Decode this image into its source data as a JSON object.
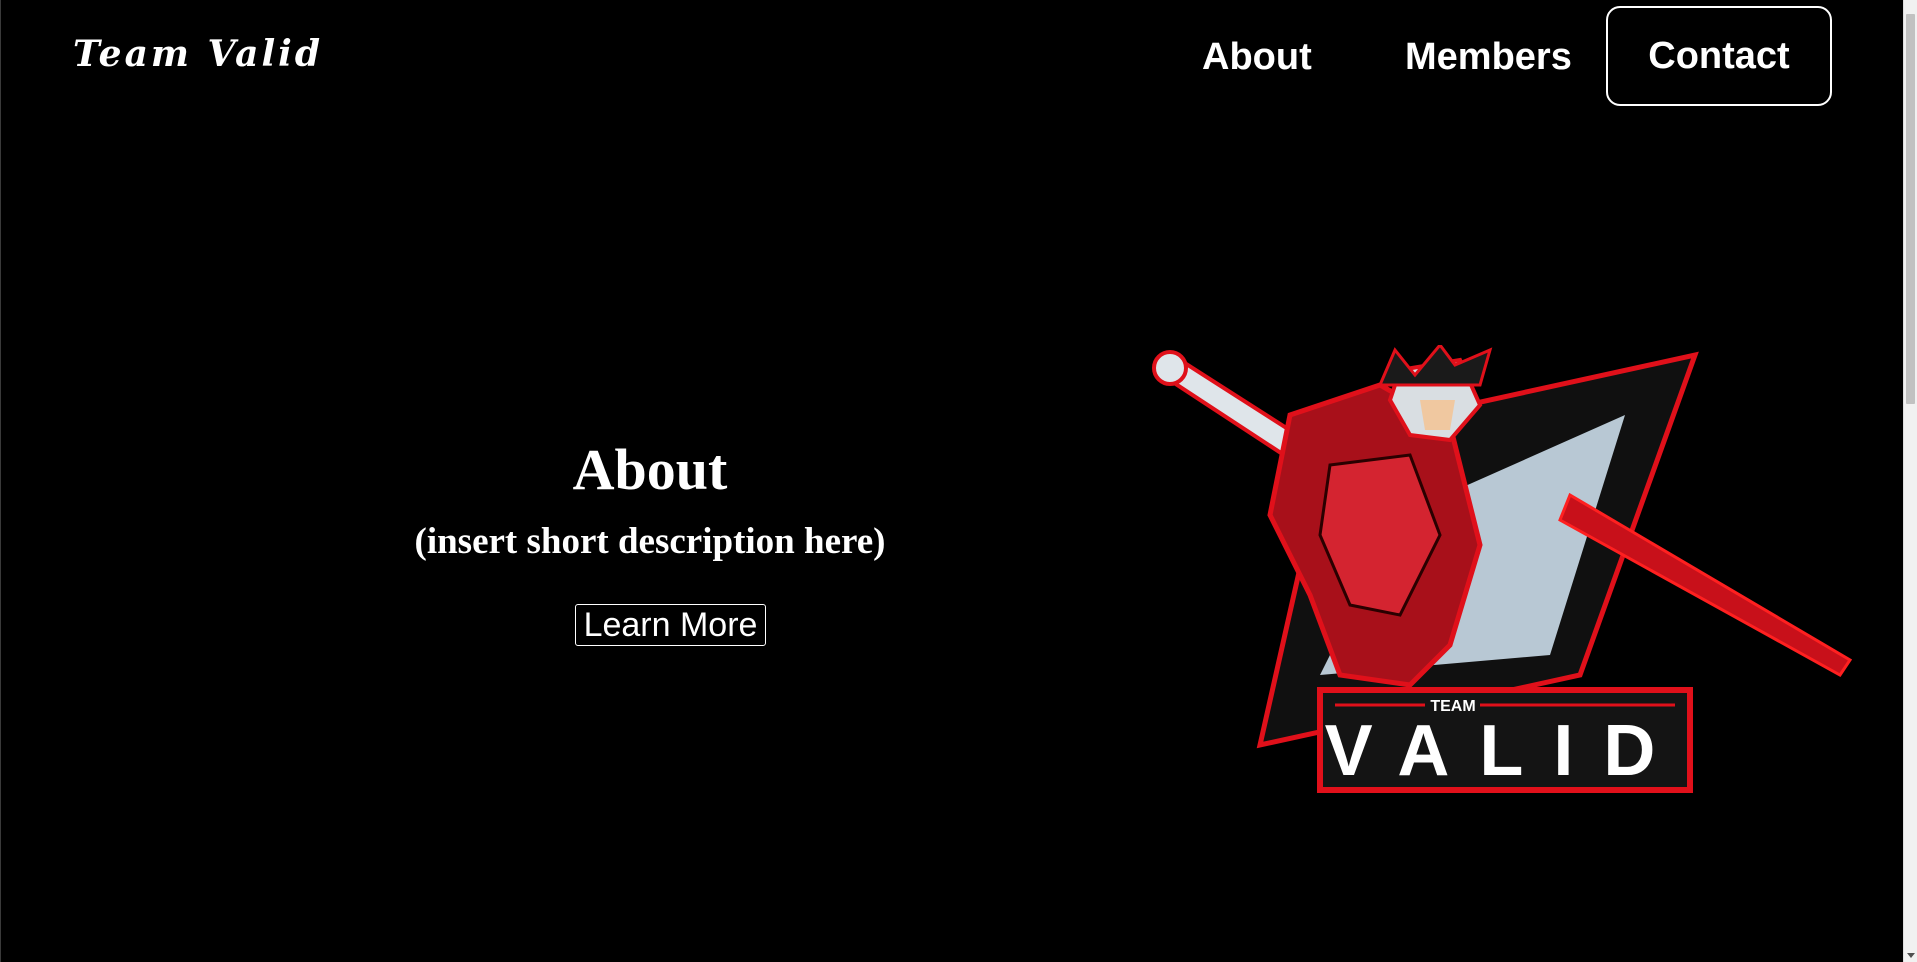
{
  "header": {
    "brand": "Team Valid",
    "nav": {
      "about": "About",
      "members": "Members",
      "contact": "Contact"
    }
  },
  "hero": {
    "title": "About",
    "subtitle": "(insert short description here)",
    "button_label": "Learn More"
  },
  "logo": {
    "small_text": "TEAM",
    "big_text": "VALID",
    "colors": {
      "primary": "#e0101a",
      "dark": "#1a1a1a",
      "light": "#b8c8d4",
      "white": "#ffffff"
    }
  }
}
